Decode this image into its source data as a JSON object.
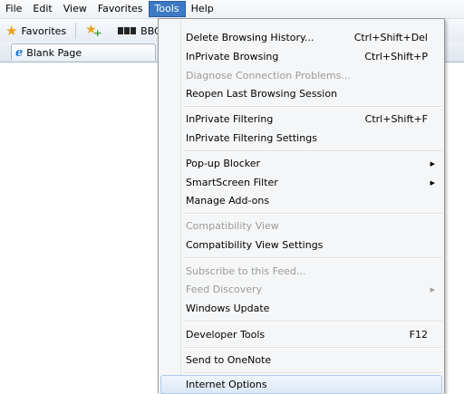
{
  "menubar": {
    "items": [
      "File",
      "Edit",
      "View",
      "Favorites",
      "Tools",
      "Help"
    ]
  },
  "favorites_bar": {
    "favorites_label": "Favorites",
    "bbc_label": "BBC - I"
  },
  "tab": {
    "title": "Blank Page"
  },
  "tools_menu": {
    "delete_history": {
      "label": "Delete Browsing History...",
      "shortcut": "Ctrl+Shift+Del"
    },
    "inprivate_browsing": {
      "label": "InPrivate Browsing",
      "shortcut": "Ctrl+Shift+P"
    },
    "diagnose": {
      "label": "Diagnose Connection Problems..."
    },
    "reopen": {
      "label": "Reopen Last Browsing Session"
    },
    "inprivate_filtering": {
      "label": "InPrivate Filtering",
      "shortcut": "Ctrl+Shift+F"
    },
    "inprivate_filtering_settings": {
      "label": "InPrivate Filtering Settings"
    },
    "popup_blocker": {
      "label": "Pop-up Blocker"
    },
    "smartscreen": {
      "label": "SmartScreen Filter"
    },
    "manage_addons": {
      "label": "Manage Add-ons"
    },
    "compat_view": {
      "label": "Compatibility View"
    },
    "compat_view_settings": {
      "label": "Compatibility View Settings"
    },
    "subscribe": {
      "label": "Subscribe to this Feed..."
    },
    "feed_discovery": {
      "label": "Feed Discovery"
    },
    "windows_update": {
      "label": "Windows Update"
    },
    "developer_tools": {
      "label": "Developer Tools",
      "shortcut": "F12"
    },
    "send_onenote": {
      "label": "Send to OneNote"
    },
    "internet_options": {
      "label": "Internet Options"
    }
  }
}
